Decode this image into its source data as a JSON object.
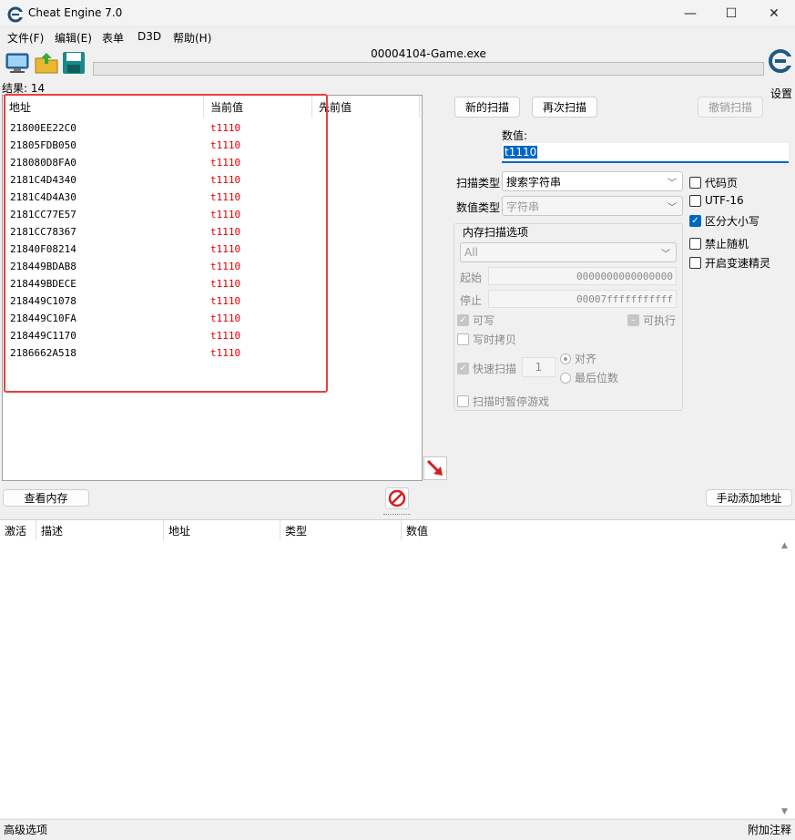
{
  "window": {
    "title": "Cheat Engine 7.0",
    "minimize": "—",
    "maximize": "☐",
    "close": "✕"
  },
  "menu": [
    "文件(F)",
    "编辑(E)",
    "表单",
    "D3D",
    "帮助(H)"
  ],
  "toolbar": {
    "process_title": "00004104-Game.exe",
    "settings_label": "设置",
    "icons": [
      "select-process-icon",
      "open-file-icon",
      "save-file-icon"
    ]
  },
  "results": {
    "count_label": "结果: 14",
    "columns": [
      "地址",
      "当前值",
      "先前值"
    ],
    "rows": [
      {
        "address": "21800EE22C0",
        "value": "t1110"
      },
      {
        "address": "21805FDB050",
        "value": "t1110"
      },
      {
        "address": "218080D8FA0",
        "value": "t1110"
      },
      {
        "address": "2181C4D4340",
        "value": "t1110"
      },
      {
        "address": "2181C4D4A30",
        "value": "t1110"
      },
      {
        "address": "2181CC77E57",
        "value": "t1110"
      },
      {
        "address": "2181CC78367",
        "value": "t1110"
      },
      {
        "address": "21840F08214",
        "value": "t1110"
      },
      {
        "address": "218449BDAB8",
        "value": "t1110"
      },
      {
        "address": "218449BDECE",
        "value": "t1110"
      },
      {
        "address": "218449C1078",
        "value": "t1110"
      },
      {
        "address": "218449C10FA",
        "value": "t1110"
      },
      {
        "address": "218449C1170",
        "value": "t1110"
      },
      {
        "address": "2186662A518",
        "value": "t1110"
      }
    ]
  },
  "scan": {
    "new_scan": "新的扫描",
    "next_scan": "再次扫描",
    "undo_scan": "撤销扫描",
    "value_label": "数值:",
    "value": "t1110",
    "scan_type_label": "扫描类型",
    "scan_type": "搜索字符串",
    "value_type_label": "数值类型",
    "value_type": "字符串",
    "options": {
      "codepage": "代码页",
      "utf16": "UTF-16",
      "case_sensitive": "区分大小写",
      "no_random": "禁止随机",
      "speedhack": "开启变速精灵"
    },
    "memory": {
      "group_label": "内存扫描选项",
      "region": "All",
      "start_label": "起始",
      "start": "0000000000000000",
      "stop_label": "停止",
      "stop": "00007fffffffffff",
      "writable": "可写",
      "executable": "可执行",
      "copy_on_write": "写时拷贝",
      "fast_scan": "快速扫描",
      "fast_scan_value": "1",
      "align": "对齐",
      "last_digits": "最后位数",
      "pause": "扫描时暂停游戏"
    }
  },
  "buttons": {
    "view_memory": "查看内存",
    "add_address": "手动添加地址"
  },
  "address_list": {
    "columns": [
      "激活",
      "描述",
      "地址",
      "类型",
      "数值"
    ]
  },
  "status": {
    "advanced": "高级选项",
    "comments": "附加注释"
  },
  "colors": {
    "accent": "#0067c0",
    "value_red": "#e00000",
    "highlight": "#e84040"
  }
}
